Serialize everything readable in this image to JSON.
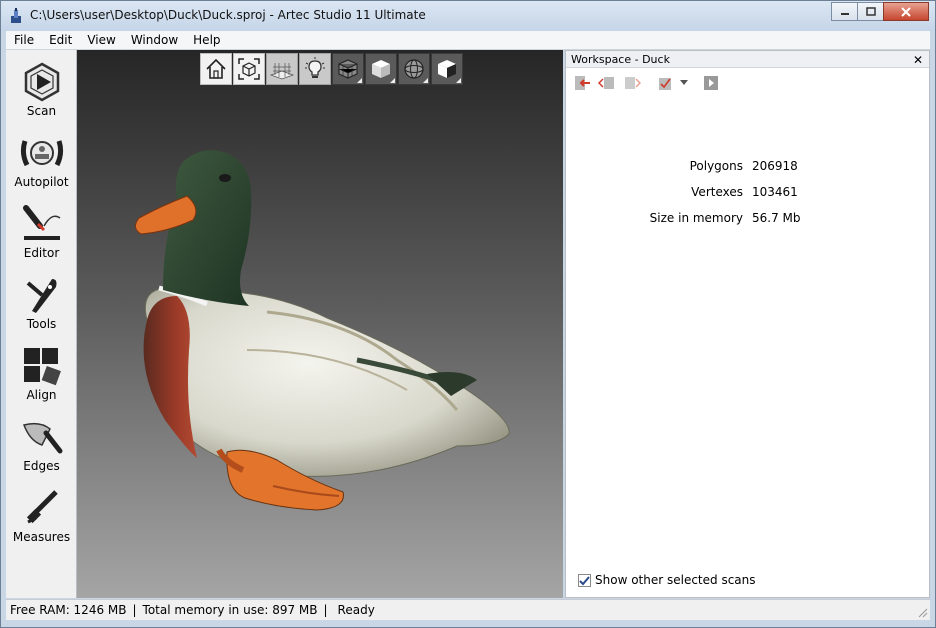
{
  "window": {
    "title": "C:\\Users\\user\\Desktop\\Duck\\Duck.sproj - Artec Studio 11 Ultimate",
    "app_icon": "artec-app-icon"
  },
  "menu": [
    "File",
    "Edit",
    "View",
    "Window",
    "Help"
  ],
  "tools": [
    {
      "label": "Scan",
      "icon": "scan-icon"
    },
    {
      "label": "Autopilot",
      "icon": "autopilot-icon"
    },
    {
      "label": "Editor",
      "icon": "editor-icon"
    },
    {
      "label": "Tools",
      "icon": "tools-icon"
    },
    {
      "label": "Align",
      "icon": "align-icon"
    },
    {
      "label": "Edges",
      "icon": "edges-icon"
    },
    {
      "label": "Measures",
      "icon": "measures-icon"
    }
  ],
  "view_toolbar": [
    {
      "icon": "home-view-icon"
    },
    {
      "icon": "fit-view-icon"
    },
    {
      "icon": "grid-icon"
    },
    {
      "icon": "light-bulb-icon"
    },
    {
      "icon": "wireframe-cube-icon"
    },
    {
      "icon": "solid-cube-icon"
    },
    {
      "icon": "sphere-icon"
    },
    {
      "icon": "textured-cube-icon"
    }
  ],
  "workspace": {
    "title": "Workspace - Duck",
    "close_glyph": "✕",
    "stats": [
      {
        "label": "Polygons",
        "value": "206918"
      },
      {
        "label": "Vertexes",
        "value": "103461"
      },
      {
        "label": "Size in memory",
        "value": "56.7 Mb"
      }
    ],
    "show_other_label": "Show other selected scans",
    "show_other_checked": true
  },
  "status": {
    "free_ram": "Free RAM: 1246 MB",
    "total_memory": "Total memory in use: 897 MB",
    "state": "Ready",
    "separator": "|"
  },
  "colors": {
    "accent_red": "#d03a2a",
    "duck_orange": "#e0712a"
  }
}
